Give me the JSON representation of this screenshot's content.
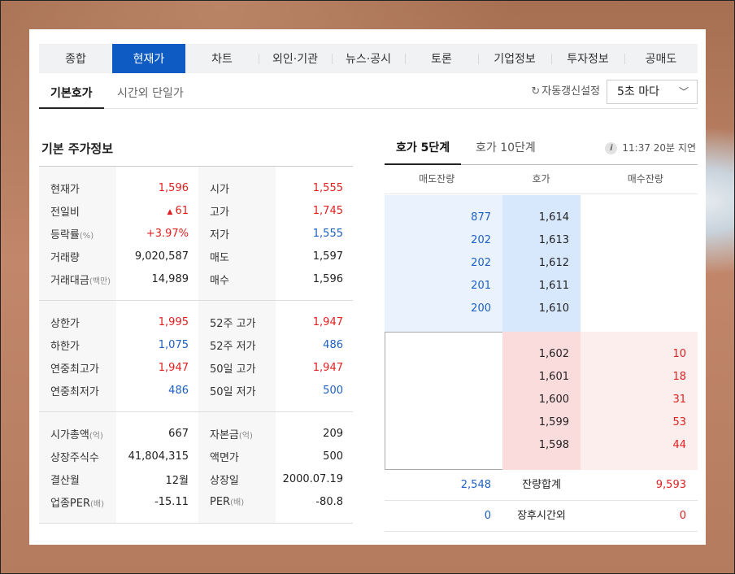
{
  "main_tabs": [
    "종합",
    "현재가",
    "차트",
    "외인·기관",
    "뉴스·공시",
    "토론",
    "기업정보",
    "투자정보",
    "공매도"
  ],
  "sub_tabs": {
    "basic": "기본호가",
    "after_hours": "시간외 단일가"
  },
  "auto_refresh": {
    "label": "자동갱신설정",
    "interval": "5초 마다"
  },
  "left": {
    "title": "기본 주가정보",
    "group1": [
      {
        "l1": "현재가",
        "s1": "",
        "v1": "1,596",
        "l2": "시가",
        "s2": "",
        "v2": "1,555"
      },
      {
        "l1": "전일비",
        "s1": "",
        "v1": "61",
        "l2": "고가",
        "s2": "",
        "v2": "1,745"
      },
      {
        "l1": "등락률",
        "s1": "(%)",
        "v1": "+3.97%",
        "l2": "저가",
        "s2": "",
        "v2": "1,555"
      },
      {
        "l1": "거래량",
        "s1": "",
        "v1": "9,020,587",
        "l2": "매도",
        "s2": "",
        "v2": "1,597"
      },
      {
        "l1": "거래대금",
        "s1": "(백만)",
        "v1": "14,989",
        "l2": "매수",
        "s2": "",
        "v2": "1,596"
      }
    ],
    "group2": [
      {
        "l1": "상한가",
        "s1": "",
        "v1": "1,995",
        "l2": "52주 고가",
        "s2": "",
        "v2": "1,947"
      },
      {
        "l1": "하한가",
        "s1": "",
        "v1": "1,075",
        "l2": "52주 저가",
        "s2": "",
        "v2": "486"
      },
      {
        "l1": "연중최고가",
        "s1": "",
        "v1": "1,947",
        "l2": "50일 고가",
        "s2": "",
        "v2": "1,947"
      },
      {
        "l1": "연중최저가",
        "s1": "",
        "v1": "486",
        "l2": "50일 저가",
        "s2": "",
        "v2": "500"
      }
    ],
    "group3": [
      {
        "l1": "시가총액",
        "s1": "(억)",
        "v1": "667",
        "l2": "자본금",
        "s2": "(억)",
        "v2": "209"
      },
      {
        "l1": "상장주식수",
        "s1": "",
        "v1": "41,804,315",
        "l2": "액면가",
        "s2": "",
        "v2": "500"
      },
      {
        "l1": "결산월",
        "s1": "",
        "v1": "12월",
        "l2": "상장일",
        "s2": "",
        "v2": "2000.07.19"
      },
      {
        "l1": "업종PER",
        "s1": "(배)",
        "v1": "-15.11",
        "l2": "PER",
        "s2": "(배)",
        "v2": "-80.8"
      }
    ]
  },
  "right": {
    "tabs": {
      "five": "호가 5단계",
      "ten": "호가 10단계"
    },
    "delay": "11:37 20분 지연",
    "info_icon": "i",
    "headers": [
      "매도잔량",
      "호가",
      "매수잔량"
    ],
    "asks": [
      {
        "qty": "877",
        "price": "1,614"
      },
      {
        "qty": "202",
        "price": "1,613"
      },
      {
        "qty": "202",
        "price": "1,612"
      },
      {
        "qty": "201",
        "price": "1,611"
      },
      {
        "qty": "200",
        "price": "1,610"
      }
    ],
    "bids": [
      {
        "price": "1,602",
        "qty": "10"
      },
      {
        "price": "1,601",
        "qty": "18"
      },
      {
        "price": "1,600",
        "qty": "31"
      },
      {
        "price": "1,599",
        "qty": "53"
      },
      {
        "price": "1,598",
        "qty": "44"
      }
    ],
    "total": {
      "ask": "2,548",
      "label": "잔량합계",
      "bid": "9,593"
    },
    "after": {
      "ask": "0",
      "label": "장후시간외",
      "bid": "0"
    }
  },
  "colors": {
    "accent": "#0f5bc4",
    "up": "#e02020",
    "down": "#1e5fc1"
  }
}
